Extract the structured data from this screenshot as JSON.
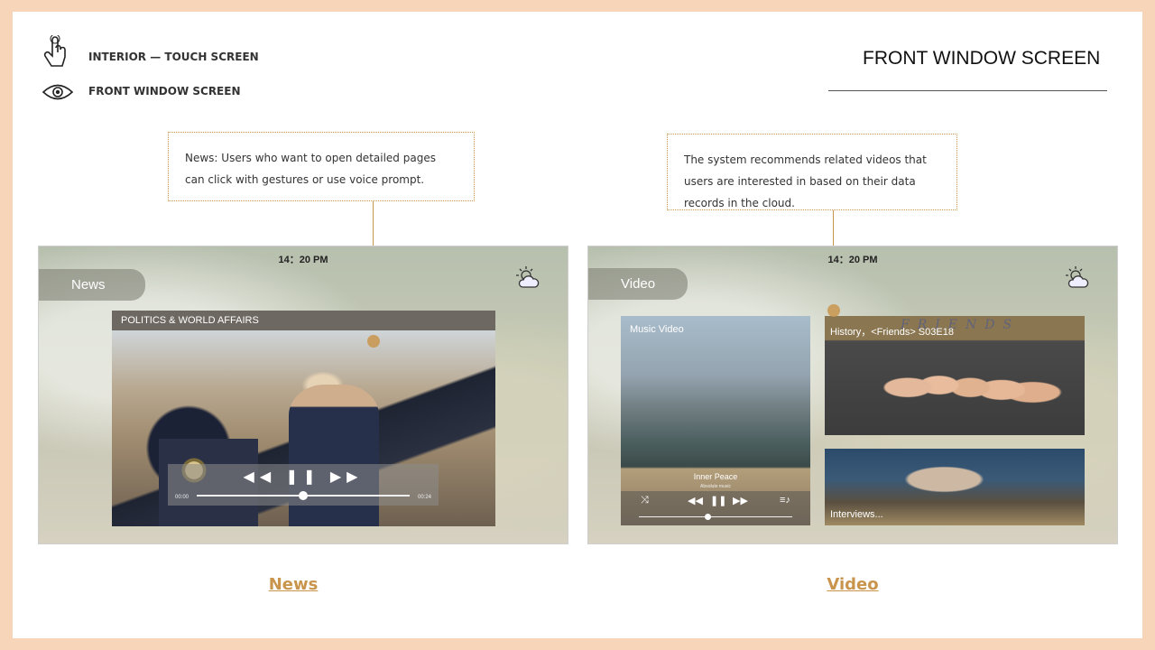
{
  "header": {
    "touch_label": "INTERIOR — TOUCH SCREEN",
    "front_label": "FRONT WINDOW SCREEN",
    "page_title": "FRONT WINDOW SCREEN"
  },
  "callouts": {
    "news": "News: Users who want to open detailed pages can click with gestures or use voice prompt.",
    "video": "The system recommends related videos that users are interested in based on their data records in the cloud."
  },
  "news_screen": {
    "time": "14：20 PM",
    "tab": "News",
    "card_title": "POLITICS & WORLD AFFAIRS",
    "elapsed": "00:00",
    "remaining": "00:24",
    "progress": 0.5
  },
  "video_screen": {
    "time": "14：20 PM",
    "tab": "Video",
    "music_card": {
      "label": "Music Video",
      "title": "Inner Peace",
      "subtitle": "Absolute music",
      "progress": 0.45
    },
    "friends_card": {
      "label": "History，<Friends> S03E18",
      "logo": "FRIENDS"
    },
    "interview_card": {
      "label": "Interviews..."
    }
  },
  "captions": {
    "news": "News",
    "video": "Video"
  }
}
